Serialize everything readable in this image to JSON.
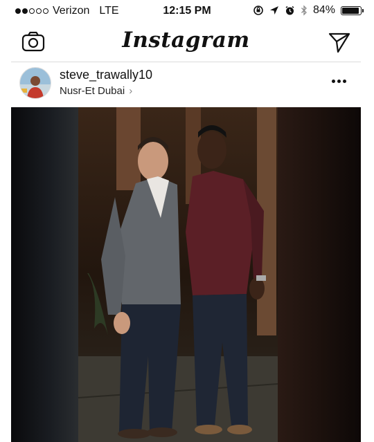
{
  "status_bar": {
    "carrier": "Verizon",
    "network": "LTE",
    "time": "12:15 PM",
    "battery_percent": "84%",
    "battery_level": 0.84,
    "signal_bars_filled": 2,
    "signal_bars_total": 5
  },
  "header": {
    "title": "Instagram",
    "left_icon": "camera-icon",
    "right_icon": "direct-send-icon"
  },
  "post": {
    "username": "steve_trawally10",
    "location": "Nusr-Et Dubai",
    "location_chevron": "›",
    "more_icon": "more-options-icon"
  },
  "colors": {
    "background": "#ffffff",
    "divider": "#dbdbdb",
    "text": "#111111"
  }
}
